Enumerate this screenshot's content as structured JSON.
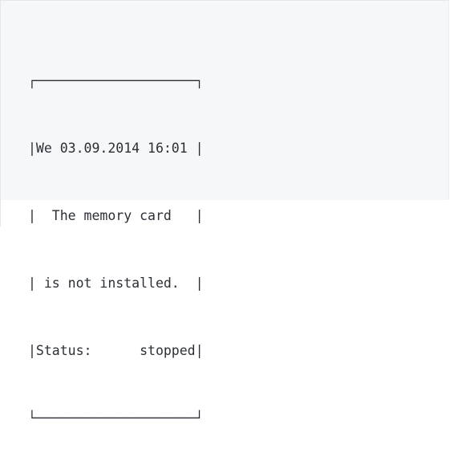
{
  "display": {
    "lines": [
      "┌────────────────────┐",
      "|We 03.09.2014 16:01 |",
      "|  The memory card   |",
      "| is not installed.  |",
      "|Status:      stopped|",
      "└────────────────────┘"
    ]
  }
}
